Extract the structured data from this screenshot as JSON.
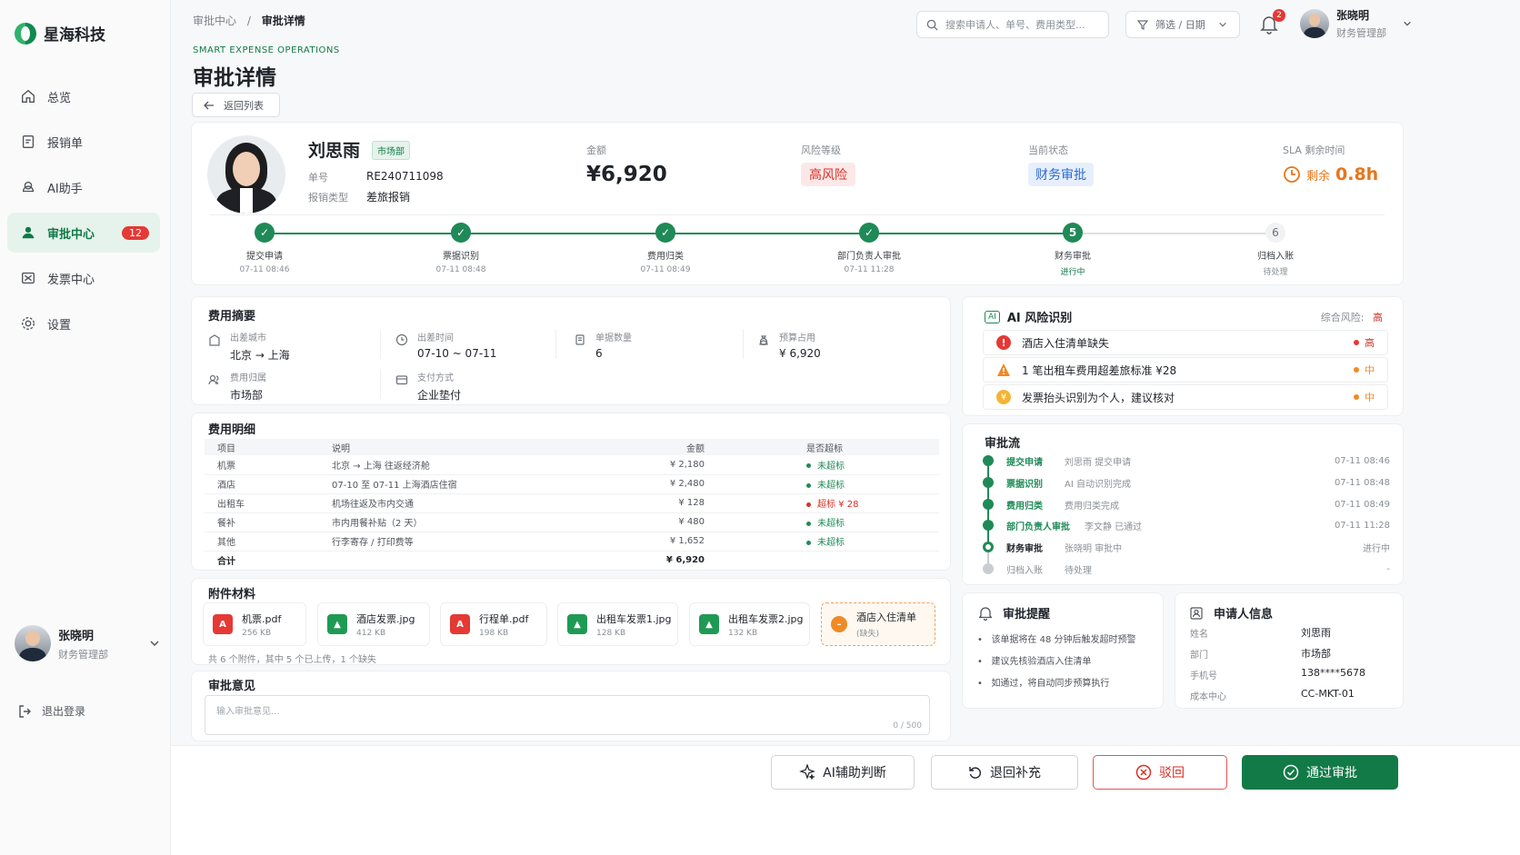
{
  "brand": {
    "name": "星海科技"
  },
  "sidebar": {
    "items": [
      {
        "label": "总览",
        "icon": "home-icon"
      },
      {
        "label": "报销单",
        "icon": "receipt-icon"
      },
      {
        "label": "AI助手",
        "icon": "robot-icon"
      },
      {
        "label": "审批中心",
        "icon": "user-icon",
        "badge": "12",
        "active": true
      },
      {
        "label": "发票中心",
        "icon": "invoice-icon"
      },
      {
        "label": "设置",
        "icon": "gear-icon"
      }
    ],
    "user": {
      "name": "张晓明",
      "role": "财务管理部"
    },
    "logout": "退出登录"
  },
  "header": {
    "breadcrumb": {
      "parent": "审批中心",
      "sep": "/",
      "current": "审批详情"
    },
    "search_placeholder": "搜索申请人、单号、费用类型...",
    "filter_label": "筛选 / 日期",
    "notif_count": "2",
    "user": {
      "name": "张晓明",
      "role": "财务管理部"
    }
  },
  "page": {
    "eyebrow": "SMART EXPENSE OPERATIONS",
    "title": "审批详情",
    "back_label": "返回列表"
  },
  "request": {
    "applicant": "刘思雨",
    "dept": "市场部",
    "no_label": "单号",
    "no": "RE240711098",
    "type_label": "报销类型",
    "type": "差旅报销",
    "amount_label": "金额",
    "amount": "¥6,920",
    "risk_label": "风险等级",
    "risk": "高风险",
    "status_label": "当前状态",
    "status": "财务审批",
    "sla_label": "SLA 剩余时间",
    "sla_prefix": "剩余",
    "sla_value": "0.8h"
  },
  "steps": [
    {
      "name": "提交申请",
      "time": "07-11 08:46",
      "state": "done"
    },
    {
      "name": "票据识别",
      "time": "07-11 08:48",
      "state": "done"
    },
    {
      "name": "费用归类",
      "time": "07-11 08:49",
      "state": "done"
    },
    {
      "name": "部门负责人审批",
      "time": "07-11 11:28",
      "state": "done"
    },
    {
      "name": "财务审批",
      "time": "进行中",
      "state": "current",
      "num": "5"
    },
    {
      "name": "归档入账",
      "time": "待处理",
      "state": "todo",
      "num": "6"
    }
  ],
  "summary": {
    "title": "费用摘要",
    "city_label": "出差城市",
    "city": "北京 → 上海",
    "date_label": "出差时间",
    "date": "07-10 ~ 07-11",
    "count_label": "单据数量",
    "count": "6",
    "budget_label": "预算占用",
    "budget": "¥ 6,920",
    "owner_label": "费用归属",
    "owner": "市场部",
    "pay_label": "支付方式",
    "pay": "企业垫付"
  },
  "detail": {
    "title": "费用明细",
    "headers": [
      "项目",
      "说明",
      "金额",
      "是否超标"
    ],
    "rows": [
      {
        "item": "机票",
        "desc": "北京 → 上海 往返经济舱",
        "amount": "¥ 2,180",
        "flag": "未超标",
        "over": false
      },
      {
        "item": "酒店",
        "desc": "07-10 至 07-11 上海酒店住宿",
        "amount": "¥ 2,480",
        "flag": "未超标",
        "over": false
      },
      {
        "item": "出租车",
        "desc": "机场往返及市内交通",
        "amount": "¥ 128",
        "flag": "超标 ¥ 28",
        "over": true
      },
      {
        "item": "餐补",
        "desc": "市内用餐补贴（2 天）",
        "amount": "¥ 480",
        "flag": "未超标",
        "over": false
      },
      {
        "item": "其他",
        "desc": "行李寄存 / 打印费等",
        "amount": "¥ 1,652",
        "flag": "未超标",
        "over": false
      }
    ],
    "total_label": "合计",
    "total": "¥ 6,920"
  },
  "attachments": {
    "title": "附件材料",
    "files": [
      {
        "name": "机票.pdf",
        "size": "256 KB",
        "kind": "pdf"
      },
      {
        "name": "酒店发票.jpg",
        "size": "412 KB",
        "kind": "img"
      },
      {
        "name": "行程单.pdf",
        "size": "198 KB",
        "kind": "pdf"
      },
      {
        "name": "出租车发票1.jpg",
        "size": "128 KB",
        "kind": "img"
      },
      {
        "name": "出租车发票2.jpg",
        "size": "132 KB",
        "kind": "img"
      },
      {
        "name": "酒店入住清单",
        "size": "(缺失)",
        "kind": "missing"
      }
    ],
    "note": "共 6 个附件，其中 5 个已上传，1 个缺失"
  },
  "opinion": {
    "title": "审批意见",
    "placeholder": "输入审批意见...",
    "count": "0 / 500"
  },
  "ai": {
    "badge": "AI",
    "title": "AI 风险识别",
    "overall_label": "综合风险:",
    "overall": "高",
    "risks": [
      {
        "text": "酒店入住清单缺失",
        "level": "高",
        "color": "#e53935"
      },
      {
        "text": "1 笔出租车费用超差旅标准 ¥28",
        "level": "中",
        "color": "#f08a24"
      },
      {
        "text": "发票抬头识别为个人，建议核对",
        "level": "中",
        "color": "#f08a24"
      }
    ]
  },
  "flow": {
    "title": "审批流",
    "rows": [
      {
        "name": "提交申请",
        "desc": "刘思雨 提交申请",
        "time": "07-11 08:46",
        "state": "done"
      },
      {
        "name": "票据识别",
        "desc": "AI 自动识别完成",
        "time": "07-11 08:48",
        "state": "done"
      },
      {
        "name": "费用归类",
        "desc": "费用归类完成",
        "time": "07-11 08:49",
        "state": "done"
      },
      {
        "name": "部门负责人审批",
        "desc": "李文静 已通过",
        "time": "07-11 11:28",
        "state": "done"
      },
      {
        "name": "财务审批",
        "desc": "张晓明 审批中",
        "time": "进行中",
        "state": "current"
      },
      {
        "name": "归档入账",
        "desc": "待处理",
        "time": "-",
        "state": "todo"
      }
    ]
  },
  "reminder": {
    "title": "审批提醒",
    "items": [
      "该单据将在 48 分钟后触发超时预警",
      "建议先核验酒店入住清单",
      "如通过，将自动同步预算执行"
    ]
  },
  "applicant_info": {
    "title": "申请人信息",
    "fields": [
      {
        "k": "姓名",
        "v": "刘思雨"
      },
      {
        "k": "部门",
        "v": "市场部"
      },
      {
        "k": "手机号",
        "v": "138****5678"
      },
      {
        "k": "成本中心",
        "v": "CC-MKT-01"
      }
    ]
  },
  "actions": {
    "ai": "AI辅助判断",
    "return": "退回补充",
    "reject": "驳回",
    "approve": "通过审批"
  }
}
